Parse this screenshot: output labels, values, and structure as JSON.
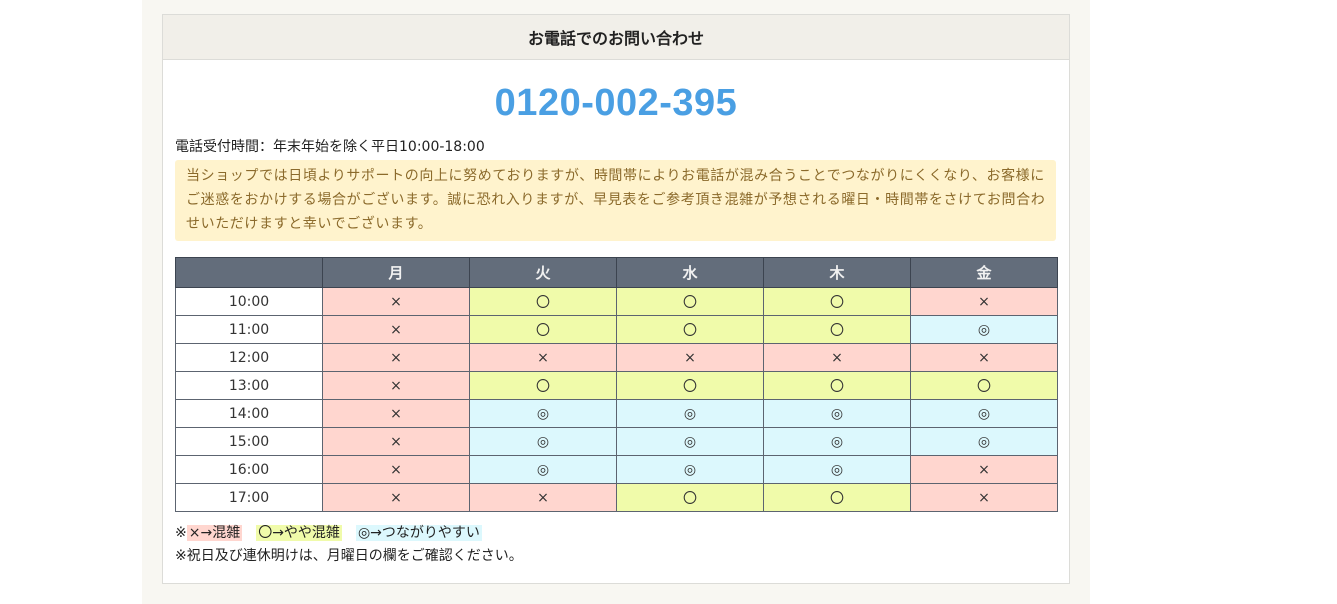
{
  "header": {
    "title": "お電話でのお問い合わせ"
  },
  "phone_number": "0120-002-395",
  "hours_text": "電話受付時間：年末年始を除く平日10:00-18:00",
  "notice_text": "当ショップでは日頃よりサポートの向上に努めておりますが、時間帯によりお電話が混み合うことでつながりにくくなり、お客様にご迷惑をおかけする場合がございます。誠に恐れ入りますが、早見表をご参考頂き混雑が予想される曜日・時間帯をさけてお問合わせいただけますと幸いでございます。",
  "table": {
    "columns": [
      "",
      "月",
      "火",
      "水",
      "木",
      "金"
    ],
    "rows": [
      {
        "time": "10:00",
        "cells": [
          "busy",
          "mid",
          "mid",
          "mid",
          "busy"
        ]
      },
      {
        "time": "11:00",
        "cells": [
          "busy",
          "mid",
          "mid",
          "mid",
          "easy"
        ]
      },
      {
        "time": "12:00",
        "cells": [
          "busy",
          "busy",
          "busy",
          "busy",
          "busy"
        ]
      },
      {
        "time": "13:00",
        "cells": [
          "busy",
          "mid",
          "mid",
          "mid",
          "mid"
        ]
      },
      {
        "time": "14:00",
        "cells": [
          "busy",
          "easy",
          "easy",
          "easy",
          "easy"
        ]
      },
      {
        "time": "15:00",
        "cells": [
          "busy",
          "easy",
          "easy",
          "easy",
          "easy"
        ]
      },
      {
        "time": "16:00",
        "cells": [
          "busy",
          "easy",
          "easy",
          "easy",
          "busy"
        ]
      },
      {
        "time": "17:00",
        "cells": [
          "busy",
          "busy",
          "mid",
          "mid",
          "busy"
        ]
      }
    ],
    "symbols": {
      "busy": "×",
      "mid": "〇",
      "easy": "◎"
    }
  },
  "legend": {
    "prefix": "※",
    "busy": "×→混雑",
    "mid": "〇→やや混雑",
    "easy": "◎→つながりやすい"
  },
  "footnote": "※祝日及び連休明けは、月曜日の欄をご確認ください。",
  "colors": {
    "busy": "#ffd6cf",
    "mid": "#f0fbaa",
    "easy": "#dcf8fd",
    "phone": "#4a9fe3",
    "header_row": "#636d7b"
  }
}
